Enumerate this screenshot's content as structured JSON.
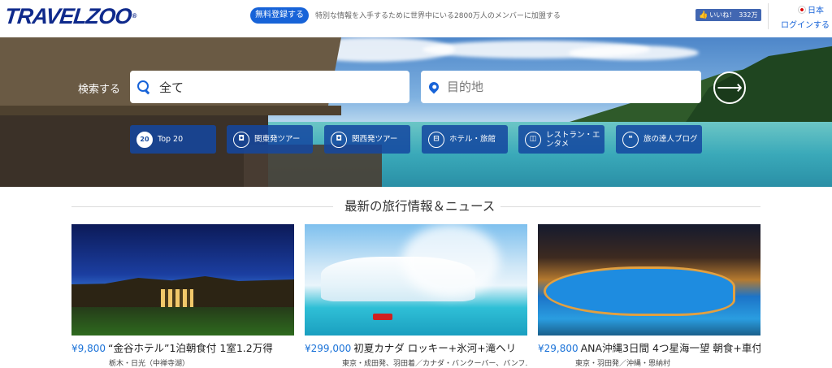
{
  "header": {
    "logo": "TRAVELZOO",
    "logo_mark": "®",
    "register_label": "無料登録する",
    "tagline": "特別な情報を入手するために世界中にいる2800万人のメンバーに加盟する",
    "like_label": "いいね！",
    "like_count": "332万",
    "country": "日本",
    "login_label": "ログインする"
  },
  "search": {
    "label": "検索する",
    "keyword_value": "全て",
    "destination_placeholder": "目的地",
    "go_symbol": "⟶"
  },
  "categories": [
    {
      "label": "Top 20",
      "icon": "top20-icon",
      "icon_text": "20"
    },
    {
      "label": "関東発ツアー",
      "icon": "camera-icon",
      "icon_text": "◘"
    },
    {
      "label": "関西発ツアー",
      "icon": "camera-icon",
      "icon_text": "◘"
    },
    {
      "label": "ホテル・旅館",
      "icon": "bed-icon",
      "icon_text": "⊟"
    },
    {
      "label": "レストラン・エンタメ",
      "icon": "ticket-icon",
      "icon_text": "◫"
    },
    {
      "label": "旅の達人ブログ",
      "icon": "quote-icon",
      "icon_text": "❝"
    }
  ],
  "news": {
    "title": "最新の旅行情報＆ニュース",
    "cards": [
      {
        "price": "¥9,800",
        "title": "“金谷ホテル”1泊朝食付 1室1.2万得",
        "subtitle": "栃木・日光（中禅寺湖）"
      },
      {
        "price": "¥299,000",
        "title": "初夏カナダ ロッキー+氷河+滝ヘリ",
        "subtitle": "東京・成田発、羽田着／カナダ・バンクーバー、バンフ..."
      },
      {
        "price": "¥29,800",
        "title": "ANA沖縄3日間 4つ星海一望 朝食+車付",
        "subtitle": "東京・羽田発／沖縄・恩納村"
      }
    ]
  },
  "colors": {
    "brand": "#0f2a8c",
    "accent": "#1763d8",
    "price": "#1a72d8"
  }
}
